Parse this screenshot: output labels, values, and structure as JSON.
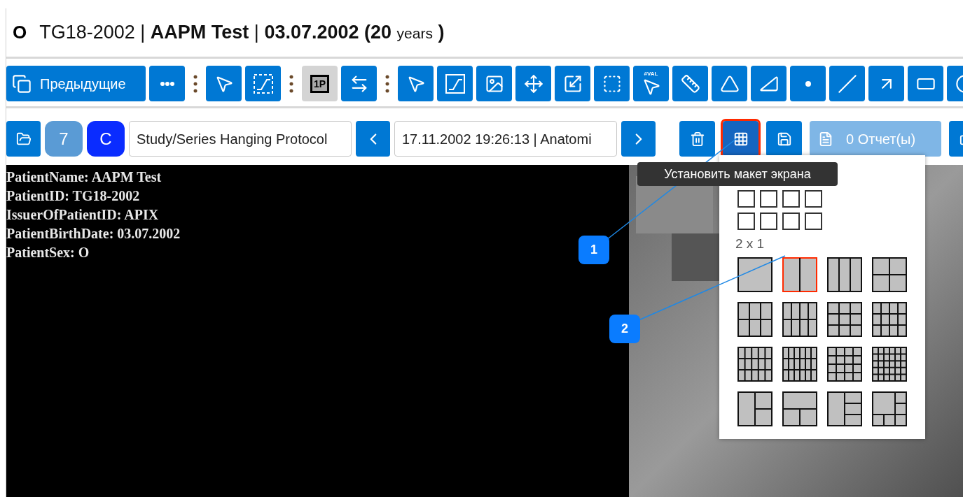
{
  "header": {
    "sex": "O",
    "title_parts": [
      {
        "kind": "plain",
        "text": "TG18-2002 | "
      },
      {
        "kind": "bold",
        "text": "AAPM Test"
      },
      {
        "kind": "plain",
        "text": " | "
      },
      {
        "kind": "bold",
        "text": "03.07.2002 (20 "
      },
      {
        "kind": "small",
        "text": "years"
      },
      {
        "kind": "bold",
        "text": " )"
      }
    ]
  },
  "toolbar": [
    {
      "kind": "text",
      "label": "Предыдущие",
      "selected": false
    },
    {
      "kind": "icon",
      "selected": false
    },
    {
      "kind": "separator"
    },
    {
      "kind": "icon",
      "selected": false
    },
    {
      "kind": "icon",
      "selected": false
    },
    {
      "kind": "separator"
    },
    {
      "kind": "mode",
      "label": "1P",
      "selected": true
    },
    {
      "kind": "icon",
      "selected": false
    },
    {
      "kind": "separator"
    },
    {
      "kind": "icon",
      "selected": false
    },
    {
      "kind": "icon",
      "selected": false
    },
    {
      "kind": "icon",
      "selected": false
    },
    {
      "kind": "icon",
      "selected": false
    },
    {
      "kind": "icon",
      "selected": false
    },
    {
      "kind": "icon",
      "selected": false
    },
    {
      "kind": "probe",
      "label": "#VAL",
      "selected": false
    },
    {
      "kind": "icon",
      "selected": false
    },
    {
      "kind": "icon",
      "selected": false
    },
    {
      "kind": "icon",
      "selected": false
    },
    {
      "kind": "icon",
      "selected": false
    },
    {
      "kind": "icon",
      "selected": false
    },
    {
      "kind": "icon",
      "selected": false
    },
    {
      "kind": "icon",
      "selected": false
    },
    {
      "kind": "icon",
      "selected": false
    }
  ],
  "navigation": [
    {
      "kind": "icon"
    },
    {
      "kind": "counter",
      "label": "7"
    },
    {
      "kind": "letter",
      "label": "C"
    },
    {
      "kind": "select",
      "value": "Study/Series Hanging Protocol"
    },
    {
      "kind": "icon"
    },
    {
      "kind": "select",
      "value": "17.11.2002 19:26:13 | Anatomi"
    },
    {
      "kind": "icon"
    }
  ],
  "actions": [
    {
      "kind": "icon",
      "highlighted": false,
      "disabled": false
    },
    {
      "kind": "icon",
      "highlighted": true,
      "disabled": false
    },
    {
      "kind": "icon",
      "highlighted": false,
      "disabled": false
    },
    {
      "kind": "report",
      "label": "0 Отчет(ы)",
      "highlighted": false,
      "disabled": true
    },
    {
      "kind": "icon",
      "highlighted": false,
      "disabled": false
    }
  ],
  "overlay_lines": [
    "PatientName: AAPM Test",
    "PatientID: TG18-2002",
    "IssuerOfPatientID: APIX",
    "PatientBirthDate: 03.07.2002",
    "PatientSex: O"
  ],
  "tooltip": "Установить макет экрана",
  "layout_menu": {
    "grid_picker": [
      {
        "selected": false
      },
      {
        "selected": false
      },
      {
        "selected": false
      },
      {
        "selected": false
      },
      {
        "selected": false
      },
      {
        "selected": false
      },
      {
        "selected": false
      },
      {
        "selected": false
      }
    ],
    "hover_label": "2 x 1",
    "layouts": [
      {
        "highlighted": false
      },
      {
        "highlighted": true
      },
      {
        "highlighted": false
      },
      {
        "highlighted": false
      },
      {
        "highlighted": false
      },
      {
        "highlighted": false
      },
      {
        "highlighted": false
      },
      {
        "highlighted": false
      },
      {
        "highlighted": false
      },
      {
        "highlighted": false
      },
      {
        "highlighted": false
      },
      {
        "highlighted": false
      },
      {
        "highlighted": false
      },
      {
        "highlighted": false
      },
      {
        "highlighted": false
      },
      {
        "highlighted": false
      }
    ]
  },
  "callouts": [
    {
      "label": "1"
    },
    {
      "label": "2"
    }
  ]
}
